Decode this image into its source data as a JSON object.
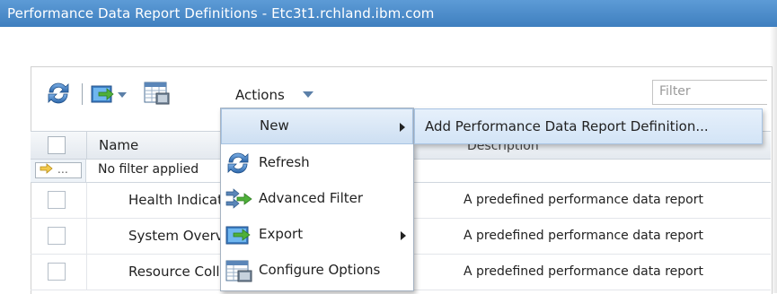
{
  "window": {
    "title": "Performance Data Report Definitions - Etc3t1.rchland.ibm.com"
  },
  "toolbar": {
    "refresh_icon": "refresh-icon",
    "export_icon": "export-icon",
    "configure_icon": "configure-columns-icon",
    "actions_label": "Actions",
    "filter_placeholder": "Filter"
  },
  "table": {
    "header_name": "Name",
    "header_description": "Description",
    "filter_row_text": "No filter applied",
    "filter_icon_text": "…",
    "rows": [
      {
        "name": "Health Indicators",
        "description": "A predefined performance data report"
      },
      {
        "name": "System Overview",
        "description": "A predefined performance data report"
      },
      {
        "name": "Resource Collection",
        "description": "A predefined performance data report"
      }
    ]
  },
  "menu": {
    "items": [
      {
        "label": "New",
        "icon": "",
        "submenu": true
      },
      {
        "label": "Refresh",
        "icon": "refresh-icon",
        "submenu": false
      },
      {
        "label": "Advanced Filter",
        "icon": "advanced-filter-icon",
        "submenu": false
      },
      {
        "label": "Export",
        "icon": "export-icon",
        "submenu": true
      },
      {
        "label": "Configure Options",
        "icon": "configure-options-icon",
        "submenu": false
      }
    ]
  },
  "submenu": {
    "items": [
      {
        "label": "Add Performance Data Report Definition..."
      }
    ]
  },
  "colors": {
    "title_bar": "#4a89c8",
    "menu_highlight": "#d6e5f5",
    "accent": "#5b7fa8"
  }
}
